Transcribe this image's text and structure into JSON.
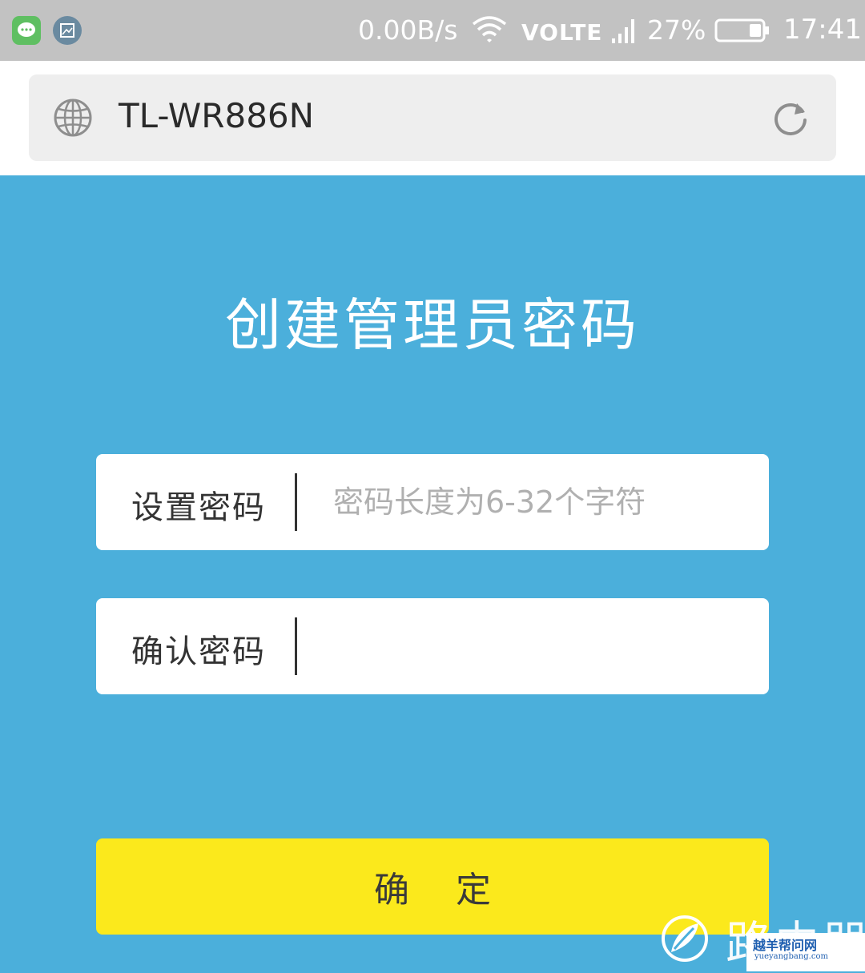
{
  "status_bar": {
    "network_speed": "0.00B/s",
    "network_type": "VOLTE",
    "battery_percent": "27%",
    "battery_level": 0.27,
    "time": "17:41",
    "icons": [
      "message-app-icon",
      "gallery-app-icon",
      "wifi-icon",
      "signal-icon",
      "battery-icon"
    ]
  },
  "address_bar": {
    "url": "TL-WR886N",
    "icons": [
      "globe-icon",
      "reload-icon"
    ]
  },
  "page": {
    "title": "创建管理员密码",
    "set_password": {
      "label": "设置密码",
      "placeholder": "密码长度为6-32个字符",
      "value": ""
    },
    "confirm_password": {
      "label": "确认密码",
      "placeholder": "",
      "value": ""
    },
    "confirm_button": "确 定"
  },
  "watermark": {
    "large_text": "路由器",
    "badge_text": "越羊帮问网",
    "badge_url": "yueyangbang.com"
  },
  "colors": {
    "background": "#4bafdb",
    "button": "#fbe91c",
    "status_bar": "#c2c2c2"
  }
}
